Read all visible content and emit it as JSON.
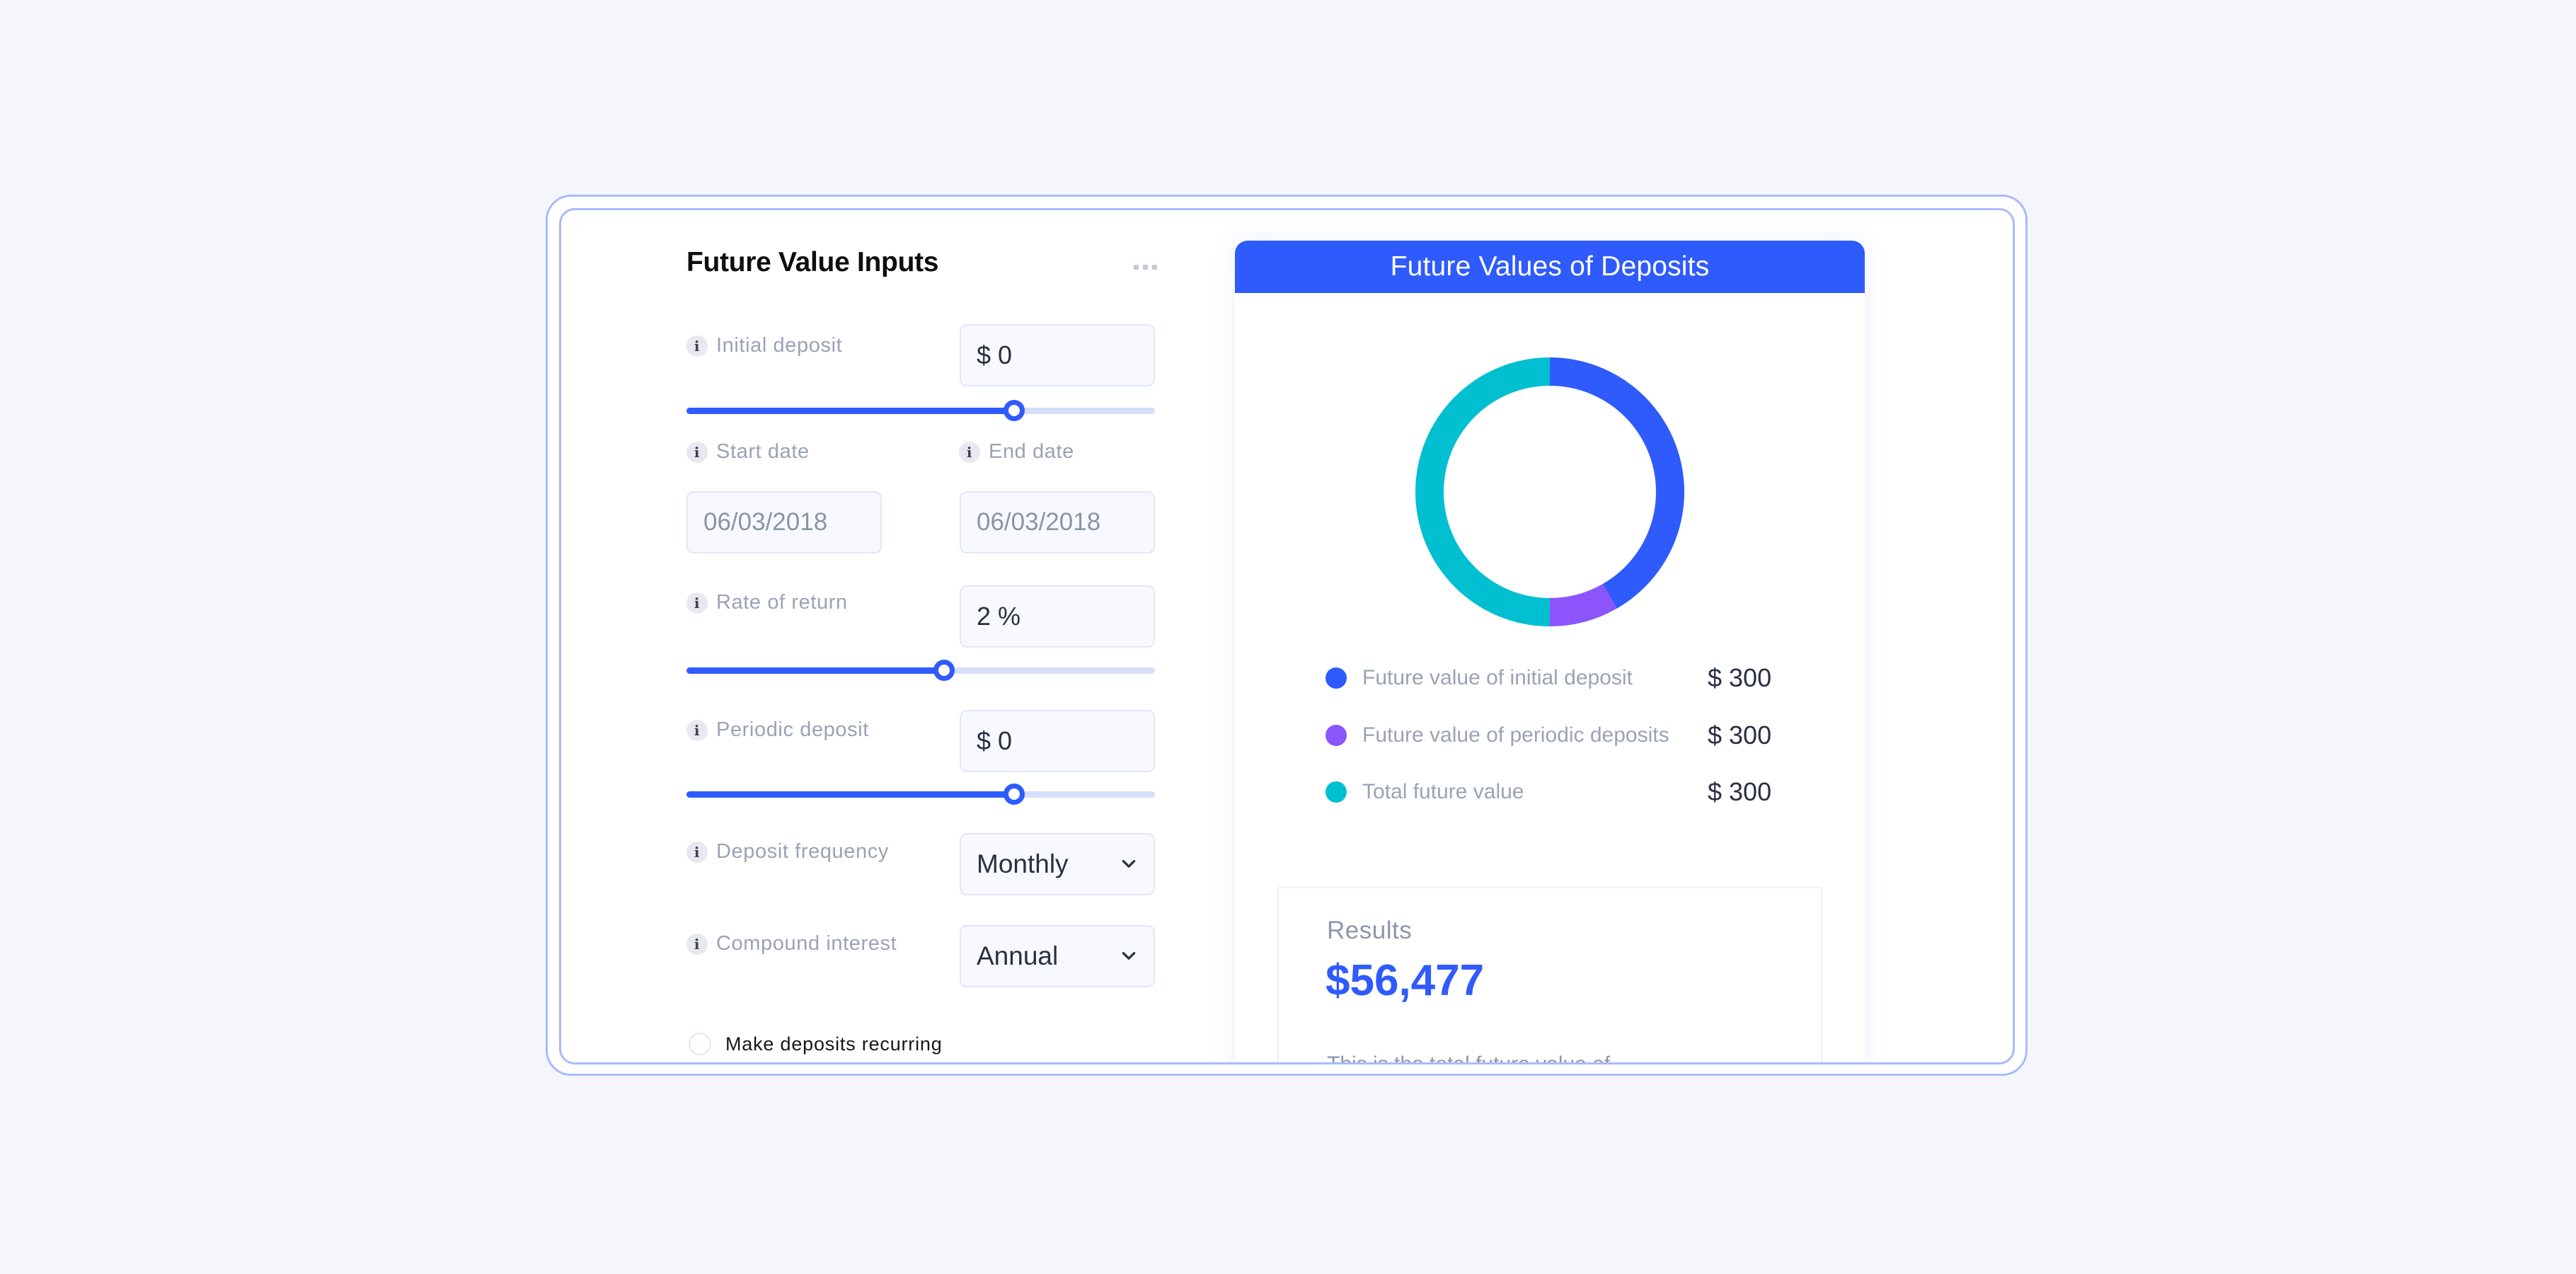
{
  "inputs_panel": {
    "title": "Future Value Inputs",
    "more_icon": "more-horizontal-icon",
    "initial_deposit": {
      "label": "Initial deposit",
      "value": "$ 0",
      "slider_fraction": 0.7
    },
    "start_date": {
      "label": "Start date",
      "value": "06/03/2018"
    },
    "end_date": {
      "label": "End date",
      "value": "06/03/2018"
    },
    "rate_of_return": {
      "label": "Rate of return",
      "value": "2 %",
      "slider_fraction": 0.55
    },
    "periodic_deposit": {
      "label": "Periodic deposit",
      "value": "$ 0",
      "slider_fraction": 0.7
    },
    "deposit_frequency": {
      "label": "Deposit frequency",
      "value": "Monthly"
    },
    "compound_interest": {
      "label": "Compound interest",
      "value": "Annual"
    },
    "recurring": {
      "label": "Make deposits recurring",
      "checked": false
    },
    "info_icon_glyph": "i"
  },
  "deposits_card": {
    "title": "Future Values of Deposits",
    "legend": [
      {
        "label": "Future value of initial deposit",
        "value": "$ 300",
        "color": "#2f5bfd"
      },
      {
        "label": "Future value of periodic  deposits",
        "value": "$ 300",
        "color": "#8c55fb"
      },
      {
        "label": "Total future value",
        "value": "$ 300",
        "color": "#00bfd1"
      }
    ]
  },
  "results": {
    "title": "Results",
    "value": "$56,477",
    "description": "This is the total future value of"
  },
  "chart_data": {
    "type": "pie",
    "variant": "donut",
    "title": "Future Values of Deposits",
    "slices": [
      {
        "name": "Future value of initial deposit",
        "share": 0.417,
        "color": "#2f5bfd"
      },
      {
        "name": "Future value of periodic  deposits",
        "share": 0.083,
        "color": "#8c55fb"
      },
      {
        "name": "Total future value",
        "share": 0.5,
        "color": "#00bfd1"
      }
    ],
    "start": "top",
    "direction": "clockwise"
  },
  "colors": {
    "accent": "#2f5bfd",
    "frame": "#a9bbfb",
    "background": "#f4f6fb"
  }
}
